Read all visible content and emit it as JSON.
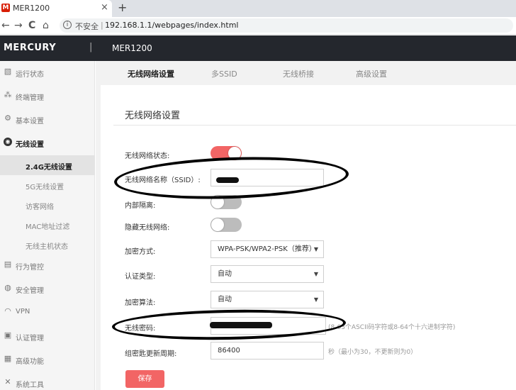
{
  "browser": {
    "tab_title": "MER1200",
    "favicon_text": "M",
    "close_glyph": "×",
    "new_tab_glyph": "+",
    "nav_back": "←",
    "nav_forward": "→",
    "nav_reload": "C",
    "nav_home": "⌂",
    "info_glyph": "i",
    "insecure_label": "不安全",
    "url_separator": "|",
    "url": "192.168.1.1/webpages/index.html"
  },
  "header": {
    "logo": "MERCURY",
    "separator": "|",
    "model": "MER1200"
  },
  "sidebar": {
    "items": [
      {
        "label": "运行状态",
        "icon": "chart-icon",
        "glyph": "▧"
      },
      {
        "label": "终端管理",
        "icon": "nodes-icon",
        "glyph": "⁂"
      },
      {
        "label": "基本设置",
        "icon": "gear-icon",
        "glyph": "⚙"
      },
      {
        "label": "无线设置",
        "icon": "wifi-icon",
        "glyph": "◉"
      }
    ],
    "sub_items": [
      {
        "label": "2.4G无线设置"
      },
      {
        "label": "5G无线设置"
      },
      {
        "label": "访客网络"
      },
      {
        "label": "MAC地址过滤"
      },
      {
        "label": "无线主机状态"
      }
    ],
    "items_after": [
      {
        "label": "行为管控",
        "icon": "control-icon",
        "glyph": "▤"
      },
      {
        "label": "安全管理",
        "icon": "shield-icon",
        "glyph": "◍"
      },
      {
        "label": "VPN",
        "icon": "vpn-icon",
        "glyph": "◠"
      },
      {
        "label": "认证管理",
        "icon": "auth-icon",
        "glyph": "▣"
      },
      {
        "label": "高级功能",
        "icon": "advanced-icon",
        "glyph": "▦"
      },
      {
        "label": "系统工具",
        "icon": "tools-icon",
        "glyph": "✕"
      }
    ]
  },
  "main": {
    "tabs": [
      "无线网络设置",
      "多SSID",
      "无线桥接",
      "高级设置"
    ],
    "panel_title": "无线网络设置",
    "form": {
      "status_label": "无线网络状态:",
      "ssid_label": "无线网络名称（SSID）:",
      "ssid_value": "",
      "isolation_label": "内部隔离:",
      "hide_label": "隐藏无线网络:",
      "encryption_label": "加密方式:",
      "encryption_value": "WPA-PSK/WPA2-PSK（推荐）",
      "auth_label": "认证类型:",
      "auth_value": "自动",
      "algorithm_label": "加密算法:",
      "algorithm_value": "自动",
      "password_label": "无线密码:",
      "password_hint": "(8-63个ASCII码字符或8-64个十六进制字符)",
      "rekey_label": "组密匙更新周期:",
      "rekey_value": "86400",
      "rekey_hint": "秒（最小为30，不更新则为0）",
      "caret": "▼",
      "save_label": "保存"
    },
    "toggles": {
      "status": true,
      "isolation": false,
      "hide": false
    }
  }
}
